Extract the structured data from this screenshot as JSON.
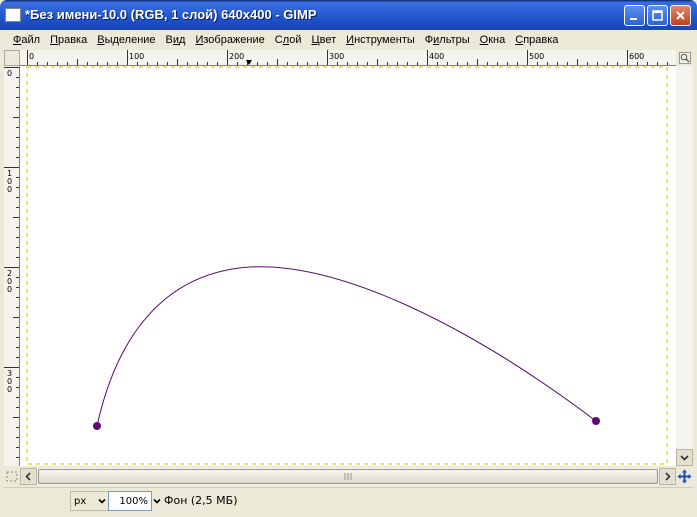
{
  "window": {
    "title": "*Без имени-10.0 (RGB, 1 слой) 640x400 - GIMP"
  },
  "menu": [
    {
      "pre": "",
      "ul": "Ф",
      "post": "айл"
    },
    {
      "pre": "",
      "ul": "П",
      "post": "равка"
    },
    {
      "pre": "",
      "ul": "В",
      "post": "ыделение"
    },
    {
      "pre": "В",
      "ul": "и",
      "post": "д"
    },
    {
      "pre": "",
      "ul": "И",
      "post": "зображение"
    },
    {
      "pre": "С",
      "ul": "л",
      "post": "ой"
    },
    {
      "pre": "",
      "ul": "Ц",
      "post": "вет"
    },
    {
      "pre": "",
      "ul": "И",
      "post": "нструменты"
    },
    {
      "pre": "Ф",
      "ul": "и",
      "post": "льтры"
    },
    {
      "pre": "",
      "ul": "О",
      "post": "кна"
    },
    {
      "pre": "",
      "ul": "С",
      "post": "правка"
    }
  ],
  "hruler_labels": [
    "0",
    "100",
    "200",
    "300",
    "400",
    "500",
    "600"
  ],
  "vruler_labels": [
    "0",
    "100",
    "200",
    "300"
  ],
  "image": {
    "width": 640,
    "height": 400,
    "path_stroke": "#5b0b6e",
    "anchor_fill": "#5b0b6e",
    "selection_border": "#d6c200"
  },
  "statusbar": {
    "unit": "px",
    "zoom": "100%",
    "layer_info": "Фон (2,5 МБ)"
  },
  "icons": {
    "minimize": "minimize-icon",
    "maximize": "maximize-icon",
    "close": "close-icon",
    "zoom": "zoom-icon",
    "navigate": "navigate-icon",
    "quick-mask": "quick-mask-icon"
  }
}
